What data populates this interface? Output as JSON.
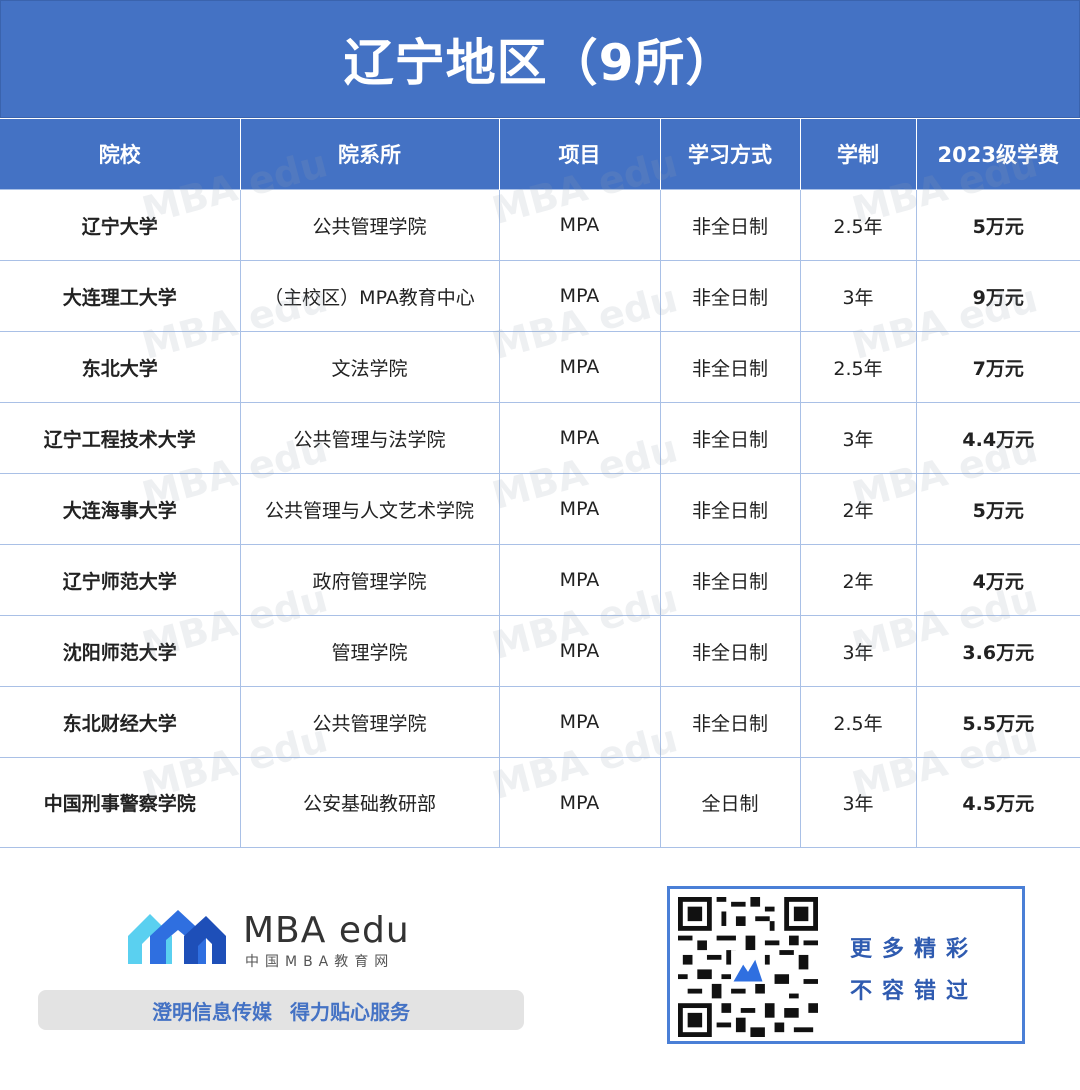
{
  "title": "辽宁地区（9所）",
  "headers": [
    "院校",
    "院系所",
    "项目",
    "学习方式",
    "学制",
    "2023级学费"
  ],
  "rows": [
    {
      "school": "辽宁大学",
      "dept": "公共管理学院",
      "program": "MPA",
      "mode": "非全日制",
      "length": "2.5年",
      "fee": "5万元"
    },
    {
      "school": "大连理工大学",
      "dept": "（主校区）MPA教育中心",
      "program": "MPA",
      "mode": "非全日制",
      "length": "3年",
      "fee": "9万元"
    },
    {
      "school": "东北大学",
      "dept": "文法学院",
      "program": "MPA",
      "mode": "非全日制",
      "length": "2.5年",
      "fee": "7万元"
    },
    {
      "school": "辽宁工程技术大学",
      "dept": "公共管理与法学院",
      "program": "MPA",
      "mode": "非全日制",
      "length": "3年",
      "fee": "4.4万元"
    },
    {
      "school": "大连海事大学",
      "dept": "公共管理与人文艺术学院",
      "program": "MPA",
      "mode": "非全日制",
      "length": "2年",
      "fee": "5万元"
    },
    {
      "school": "辽宁师范大学",
      "dept": "政府管理学院",
      "program": "MPA",
      "mode": "非全日制",
      "length": "2年",
      "fee": "4万元"
    },
    {
      "school": "沈阳师范大学",
      "dept": "管理学院",
      "program": "MPA",
      "mode": "非全日制",
      "length": "3年",
      "fee": "3.6万元"
    },
    {
      "school": "东北财经大学",
      "dept": "公共管理学院",
      "program": "MPA",
      "mode": "非全日制",
      "length": "2.5年",
      "fee": "5.5万元"
    },
    {
      "school": "中国刑事警察学院",
      "dept": "公安基础教研部",
      "program": "MPA",
      "mode": "全日制",
      "length": "3年",
      "fee": "4.5万元"
    }
  ],
  "footer": {
    "logo_text": "MBA edu",
    "logo_sub": "中国MBA教育网",
    "slogan_left": "澄明信息传媒",
    "slogan_right": "得力贴心服务",
    "qr_line1": "更多精彩",
    "qr_line2": "不容错过"
  },
  "watermark": "MBA edu",
  "colors": {
    "header_bg": "#4472c4",
    "fee_text": "#4472c4",
    "grid": "#a9c0e6"
  }
}
